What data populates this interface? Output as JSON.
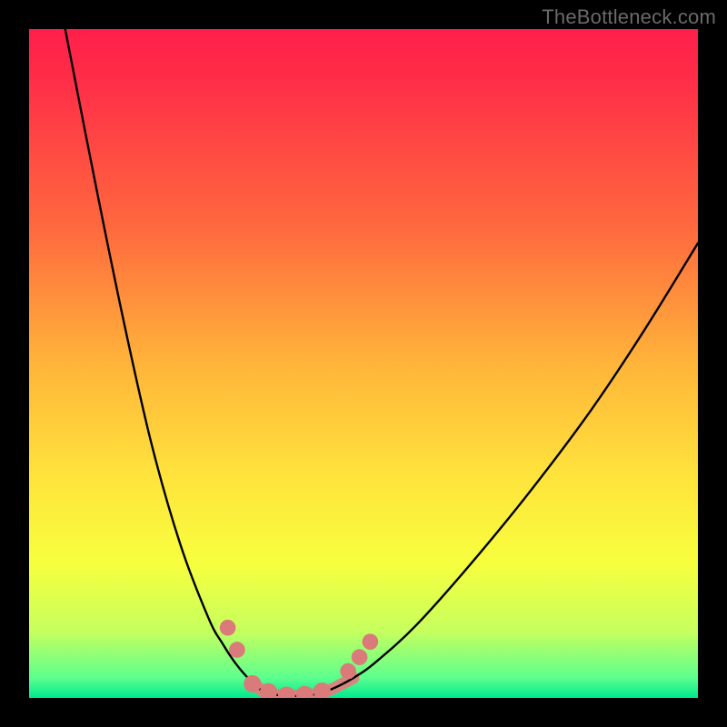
{
  "watermark": {
    "text": "TheBottleneck.com"
  },
  "gradient_colors": {
    "top": "#ff1f4a",
    "mid_upper": "#ff6a3e",
    "mid": "#ffe43c",
    "mid_lower": "#c6ff5e",
    "bottom": "#00e98f"
  },
  "chart_data": {
    "type": "line",
    "title": "",
    "xlabel": "",
    "ylabel": "",
    "xlim": [
      0,
      100
    ],
    "ylim": [
      0,
      100
    ],
    "grid": false,
    "legend": false,
    "annotations": [],
    "series": [
      {
        "name": "left-arm",
        "stroke": "#000000",
        "x": [
          5.4,
          9.7,
          14.0,
          18.3,
          22.6,
          26.8,
          29.0,
          31.0,
          33.2,
          35.3
        ],
        "y": [
          100.0,
          78.0,
          57.0,
          38.0,
          23.0,
          12.0,
          8.0,
          5.0,
          2.5,
          0.8
        ]
      },
      {
        "name": "valley-floor",
        "stroke": "#000000",
        "x": [
          35.3,
          37.5,
          40.0,
          42.5,
          45.0
        ],
        "y": [
          0.8,
          0.4,
          0.3,
          0.5,
          1.2
        ]
      },
      {
        "name": "right-arm",
        "stroke": "#000000",
        "x": [
          45.0,
          48.5,
          52.0,
          58.0,
          66.0,
          75.0,
          84.0,
          92.0,
          100.0
        ],
        "y": [
          1.2,
          3.0,
          5.5,
          11.0,
          20.0,
          31.0,
          43.0,
          55.0,
          68.0
        ]
      }
    ],
    "markers": [
      {
        "name": "left-tick-upper",
        "x": 29.7,
        "y": 10.5,
        "r": 1.2,
        "fill": "#db7a7a"
      },
      {
        "name": "left-tick-lower",
        "x": 31.1,
        "y": 7.2,
        "r": 1.2,
        "fill": "#db7a7a"
      },
      {
        "name": "valley-1",
        "x": 33.4,
        "y": 2.1,
        "r": 1.3,
        "fill": "#db7a7a"
      },
      {
        "name": "valley-2",
        "x": 35.8,
        "y": 0.9,
        "r": 1.3,
        "fill": "#db7a7a"
      },
      {
        "name": "valley-3",
        "x": 38.5,
        "y": 0.4,
        "r": 1.3,
        "fill": "#db7a7a"
      },
      {
        "name": "valley-4",
        "x": 41.2,
        "y": 0.5,
        "r": 1.3,
        "fill": "#db7a7a"
      },
      {
        "name": "valley-5",
        "x": 43.8,
        "y": 1.0,
        "r": 1.3,
        "fill": "#db7a7a"
      },
      {
        "name": "right-tick-lower",
        "x": 47.7,
        "y": 4.0,
        "r": 1.2,
        "fill": "#db7a7a"
      },
      {
        "name": "right-tick-mid",
        "x": 49.4,
        "y": 6.1,
        "r": 1.2,
        "fill": "#db7a7a"
      },
      {
        "name": "right-tick-upper",
        "x": 51.0,
        "y": 8.4,
        "r": 1.2,
        "fill": "#db7a7a"
      }
    ]
  }
}
